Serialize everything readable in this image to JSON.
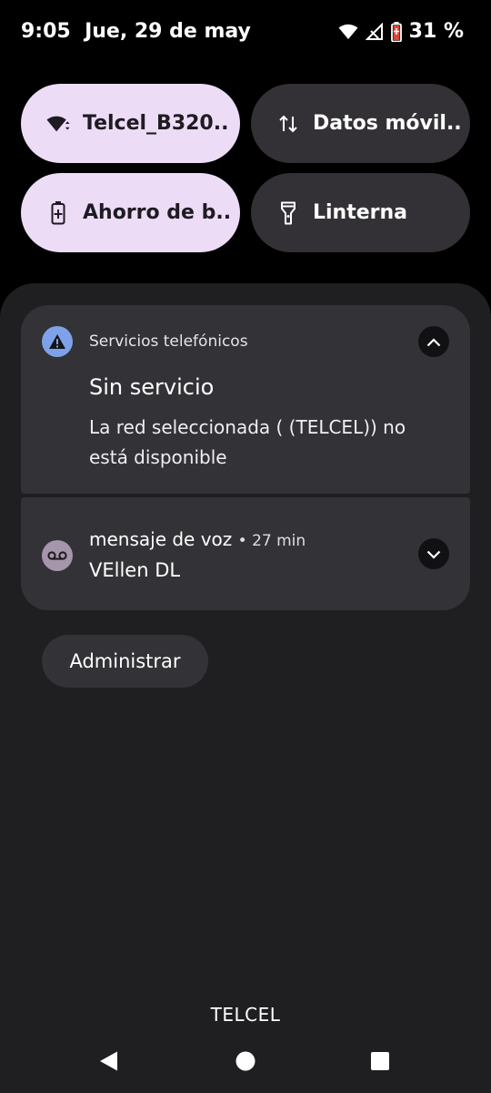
{
  "status_bar": {
    "time": "9:05",
    "date": "Jue, 29 de may",
    "battery_percent": "31 %",
    "icons": [
      "wifi-icon",
      "no-signal-icon",
      "battery-saver-icon"
    ]
  },
  "quick_settings": [
    {
      "label": "Telcel_B320..",
      "icon": "wifi-icon",
      "active": true
    },
    {
      "label": "Datos móvil..",
      "icon": "mobile-data-icon",
      "active": false
    },
    {
      "label": "Ahorro de b..",
      "icon": "battery-saver-icon",
      "active": true
    },
    {
      "label": "Linterna",
      "icon": "flashlight-icon",
      "active": false
    }
  ],
  "notifications": [
    {
      "app": "Servicios telefónicos",
      "title": "Sin servicio",
      "body": "La red seleccionada ( (TELCEL)) no está disponible",
      "icon": "warning-icon",
      "expanded": true
    },
    {
      "app": "mensaje de voz",
      "time": "• 27 min",
      "body": "VEllen DL",
      "icon": "voicemail-icon",
      "expanded": false
    }
  ],
  "manage_label": "Administrar",
  "carrier": "TELCEL",
  "nav": [
    "back-icon",
    "home-icon",
    "recents-icon"
  ],
  "colors": {
    "tile_on": "#ecdcf6",
    "tile_off": "#333135",
    "shade": "#1f1e21",
    "card": "#333236",
    "warning_icon_bg": "#7ea2ea",
    "voicemail_icon_bg": "#a596ac"
  }
}
